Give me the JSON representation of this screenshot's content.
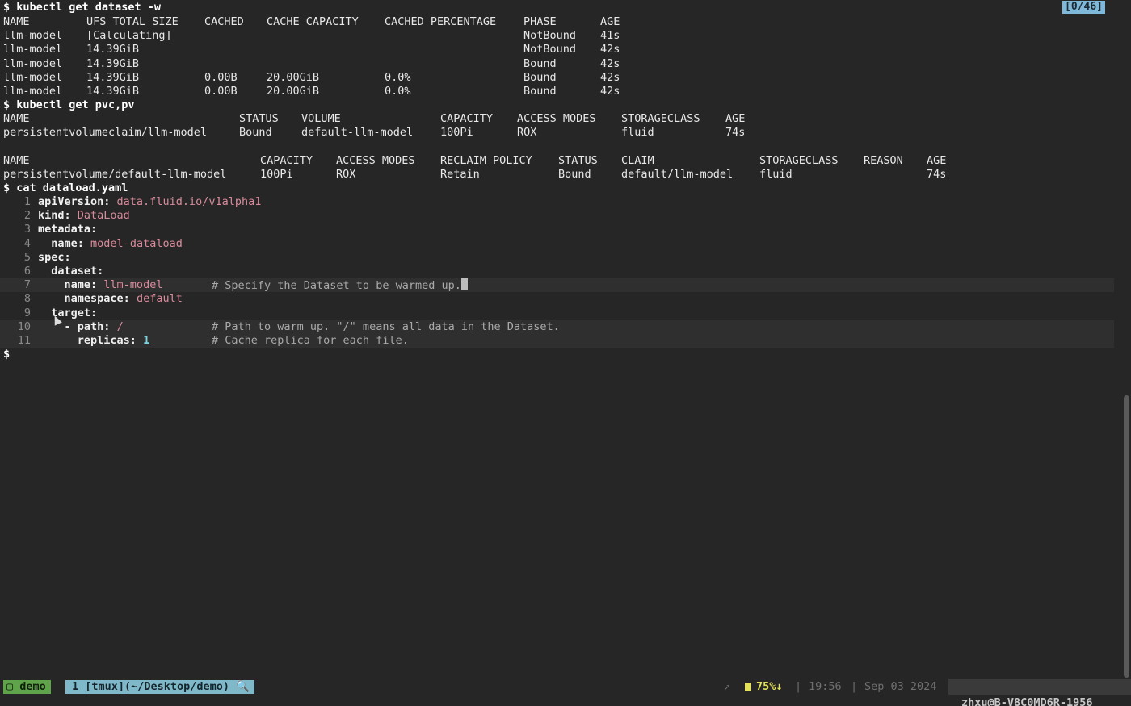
{
  "pager_indicator": "[0/46]",
  "dataset": {
    "prompt": "$ kubectl get dataset -w",
    "headers": [
      "NAME",
      "UFS TOTAL SIZE",
      "CACHED",
      "CACHE CAPACITY",
      "CACHED PERCENTAGE",
      "PHASE",
      "AGE"
    ],
    "rows": [
      [
        "llm-model",
        "[Calculating]",
        "",
        "",
        "",
        "NotBound",
        "41s"
      ],
      [
        "llm-model",
        "14.39GiB",
        "",
        "",
        "",
        "NotBound",
        "42s"
      ],
      [
        "llm-model",
        "14.39GiB",
        "",
        "",
        "",
        "Bound",
        "42s"
      ],
      [
        "llm-model",
        "14.39GiB",
        "0.00B",
        "20.00GiB",
        "0.0%",
        "Bound",
        "42s"
      ],
      [
        "llm-model",
        "14.39GiB",
        "0.00B",
        "20.00GiB",
        "0.0%",
        "Bound",
        "42s"
      ]
    ]
  },
  "pvc": {
    "prompt": "$ kubectl get pvc,pv",
    "headers": [
      "NAME",
      "STATUS",
      "VOLUME",
      "CAPACITY",
      "ACCESS MODES",
      "STORAGECLASS",
      "AGE"
    ],
    "rows": [
      [
        "persistentvolumeclaim/llm-model",
        "Bound",
        "default-llm-model",
        "100Pi",
        "ROX",
        "fluid",
        "74s"
      ]
    ]
  },
  "pv": {
    "headers": [
      "NAME",
      "CAPACITY",
      "ACCESS MODES",
      "RECLAIM POLICY",
      "STATUS",
      "CLAIM",
      "STORAGECLASS",
      "REASON",
      "AGE"
    ],
    "rows": [
      [
        "persistentvolume/default-llm-model",
        "100Pi",
        "ROX",
        "Retain",
        "Bound",
        "default/llm-model",
        "fluid",
        "",
        "74s"
      ]
    ]
  },
  "cat_prompt": "$ cat dataload.yaml",
  "yaml": [
    {
      "n": "1",
      "indent": "",
      "key": "apiVersion:",
      "val": "data.fluid.io/v1alpha1",
      "comment": ""
    },
    {
      "n": "2",
      "indent": "",
      "key": "kind:",
      "val": "DataLoad",
      "comment": ""
    },
    {
      "n": "3",
      "indent": "",
      "key": "metadata:",
      "val": "",
      "comment": ""
    },
    {
      "n": "4",
      "indent": "  ",
      "key": "name:",
      "val": "model-dataload",
      "comment": ""
    },
    {
      "n": "5",
      "indent": "",
      "key": "spec:",
      "val": "",
      "comment": ""
    },
    {
      "n": "6",
      "indent": "  ",
      "key": "dataset:",
      "val": "",
      "comment": ""
    },
    {
      "n": "7",
      "indent": "    ",
      "key": "name:",
      "val": "llm-model",
      "comment": "# Specify the Dataset to be warmed up."
    },
    {
      "n": "8",
      "indent": "    ",
      "key": "namespace:",
      "val": "default",
      "comment": ""
    },
    {
      "n": "9",
      "indent": "  ",
      "key": "target:",
      "val": "",
      "comment": ""
    },
    {
      "n": "10",
      "indent": "    ",
      "key": "- path:",
      "val": "/",
      "comment": "# Path to warm up. \"/\" means all data in the Dataset."
    },
    {
      "n": "11",
      "indent": "      ",
      "key": "replicas:",
      "val": "1",
      "comment": "# Cache replica for each file."
    }
  ],
  "final_prompt": "$",
  "status": {
    "session": "demo",
    "window": "1 [tmux](~/Desktop/demo)",
    "arrow": "↗",
    "battery": "75%↓",
    "time": "19:56",
    "date": "Sep 03 2024",
    "host": "zhxu@B-V8C0MD6R-1956",
    "tail": "–"
  },
  "colors": {
    "background": "#262626",
    "session_bg": "#5fa34a",
    "window_bg": "#7fb8c8",
    "battery": "#e3e05a",
    "yaml_value": "#d98a9b"
  }
}
